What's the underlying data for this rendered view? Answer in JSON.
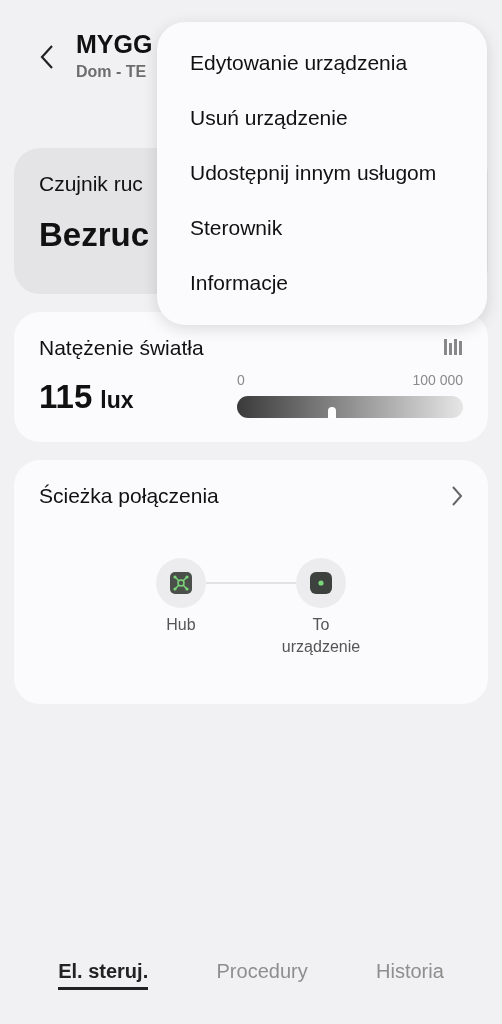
{
  "header": {
    "title": "MYGG",
    "subtitle": "Dom - TE"
  },
  "status_card": {
    "label": "Czujnik ruc",
    "value": "Bezruc"
  },
  "light_card": {
    "title": "Natężenie światła",
    "value": "115",
    "unit": "lux",
    "min_label": "0",
    "max_label": "100 000",
    "level": 0.42
  },
  "path_card": {
    "title": "Ścieżka połączenia",
    "nodes": [
      {
        "kind": "hub",
        "label": "Hub"
      },
      {
        "kind": "device",
        "label": "To urządzenie"
      }
    ]
  },
  "menu": {
    "items": [
      "Edytowanie urządzenia",
      "Usuń urządzenie",
      "Udostępnij innym usługom",
      "Sterownik",
      "Informacje"
    ]
  },
  "tabs": [
    {
      "label": "El. steruj.",
      "selected": true
    },
    {
      "label": "Procedury",
      "selected": false
    },
    {
      "label": "Historia",
      "selected": false
    }
  ]
}
